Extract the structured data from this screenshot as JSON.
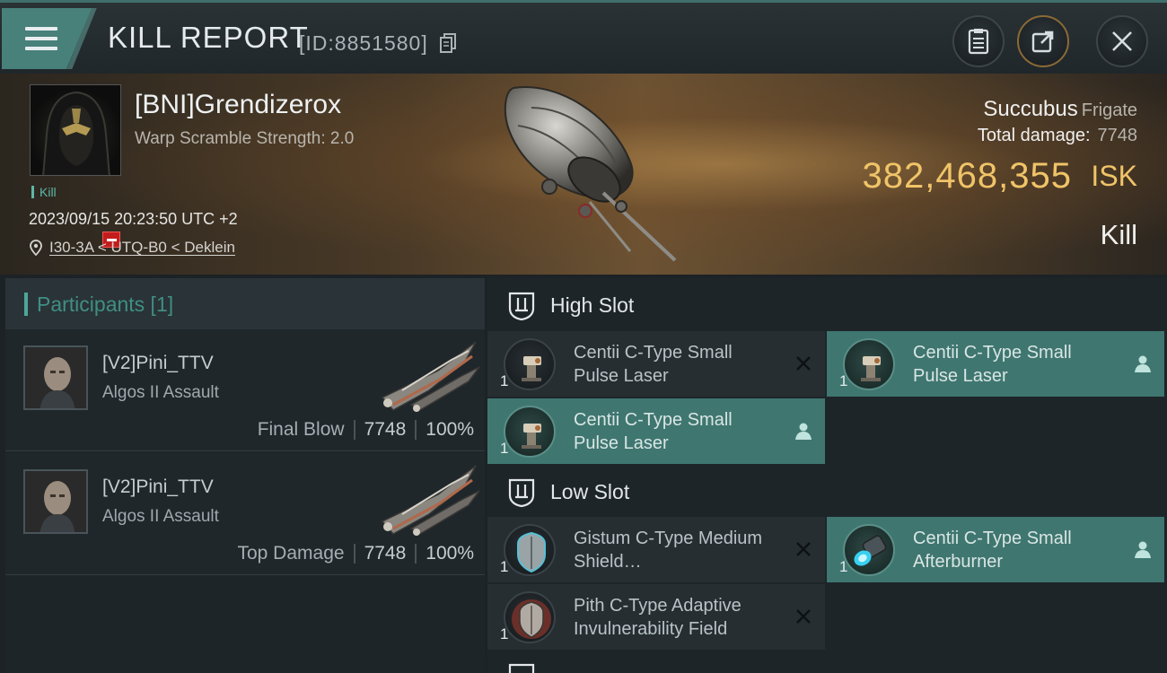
{
  "header": {
    "title": "KILL REPORT",
    "report_id": "[ID:8851580]"
  },
  "victim": {
    "name": "[BNI]Grendizerox",
    "warp_scramble": "Warp Scramble Strength: 2.0",
    "tag": "Kill",
    "timestamp": "2023/09/15 20:23:50 UTC +2",
    "location": "I30-3A < UTQ-B0 < Deklein",
    "ship_name": "Succubus",
    "ship_class": "Frigate",
    "total_damage_label": "Total damage:",
    "total_damage_value": "7748",
    "isk_value": "382,468,355",
    "isk_unit": "ISK",
    "outcome": "Kill"
  },
  "participants": {
    "label": "Participants [1]",
    "rows": [
      {
        "name": "[V2]Pini_TTV",
        "ship": "Algos II Assault",
        "role": "Final Blow",
        "damage": "7748",
        "percent": "100%"
      },
      {
        "name": "[V2]Pini_TTV",
        "ship": "Algos II Assault",
        "role": "Top Damage",
        "damage": "7748",
        "percent": "100%"
      }
    ]
  },
  "slots": {
    "high": {
      "title": "High Slot",
      "modules": [
        {
          "qty": "1",
          "name": "Centii C-Type Small Pulse Laser",
          "state": "destroyed",
          "icon": "pulse-laser-icon"
        },
        {
          "qty": "1",
          "name": "Centii C-Type Small Pulse Laser",
          "state": "dropped",
          "icon": "pulse-laser-icon"
        },
        {
          "qty": "1",
          "name": "Centii C-Type Small Pulse Laser",
          "state": "dropped",
          "icon": "pulse-laser-icon"
        }
      ]
    },
    "low": {
      "title": "Low Slot",
      "modules": [
        {
          "qty": "1",
          "name": "Gistum C-Type Medium Shield…",
          "state": "destroyed",
          "icon": "shield-extender-icon"
        },
        {
          "qty": "1",
          "name": "Centii C-Type Small Afterburner",
          "state": "dropped",
          "icon": "afterburner-icon"
        },
        {
          "qty": "1",
          "name": "Pith C-Type Adaptive Invulnerability Field",
          "state": "destroyed",
          "icon": "invulnerability-field-icon"
        }
      ]
    }
  },
  "colors": {
    "accent": "#4fa69a",
    "isk": "#f0c468",
    "active_module": "#3f7670",
    "badge_red": "#c21d1d"
  }
}
